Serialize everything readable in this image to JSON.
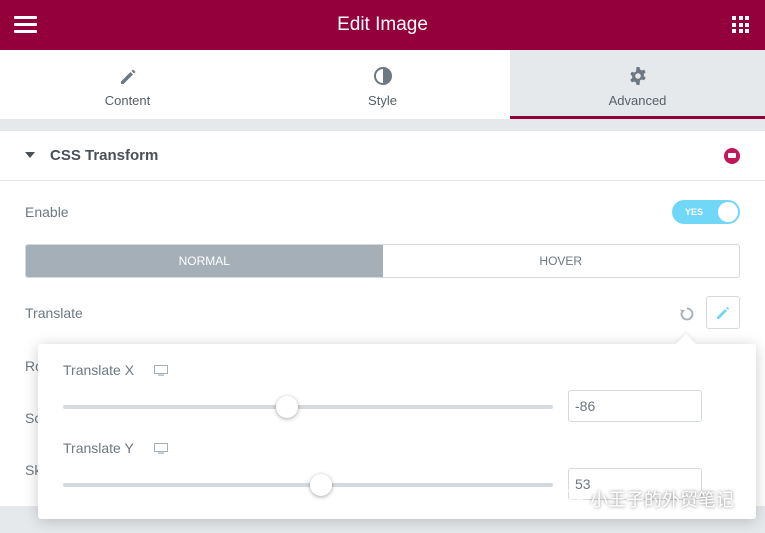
{
  "header": {
    "title": "Edit Image",
    "menu_icon": "hamburger-icon",
    "apps_icon": "grid-icon"
  },
  "tabs": [
    {
      "label": "Content",
      "icon": "pencil-icon",
      "active": false
    },
    {
      "label": "Style",
      "icon": "half-circle-icon",
      "active": false
    },
    {
      "label": "Advanced",
      "icon": "gear-icon",
      "active": true
    }
  ],
  "section": {
    "title": "CSS Transform",
    "enable_label": "Enable",
    "enable_toggle": "YES",
    "state_tabs": [
      "NORMAL",
      "HOVER"
    ],
    "translate_label": "Translate",
    "rotate_label_partial": "Ro",
    "scale_label_partial": "Sc",
    "skew_label_partial": "Sk"
  },
  "popover": {
    "translate_x": {
      "label": "Translate X",
      "value": "-86",
      "slider_fraction": 0.457
    },
    "translate_y": {
      "label": "Translate Y",
      "value": "53",
      "slider_fraction": 0.526
    }
  },
  "watermark": {
    "text": "小王子的外贸笔记"
  },
  "colors": {
    "brand": "#93003c",
    "toggle": "#71d7f7",
    "active_seg": "#a4afb7"
  }
}
